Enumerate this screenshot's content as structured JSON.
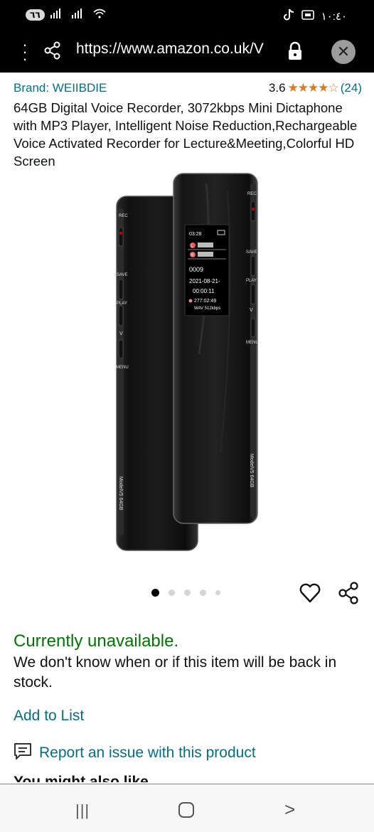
{
  "status_bar": {
    "badge": "٦٦",
    "time": "١٠:٤٠"
  },
  "browser": {
    "url": "https://www.amazon.co.uk/V"
  },
  "product": {
    "brand": "Brand: WEIIBDIE",
    "rating_value": "3.6",
    "rating_stars": 3.6,
    "rating_count": "(24)",
    "title": "64GB Digital Voice Recorder, 3072kbps Mini Dictaphone with MP3 Player, Intelligent Noise Reduction,Rechargeable Voice Activated Recorder for Lecture&Meeting,Colorful HD Screen",
    "image": {
      "back_buttons": [
        "REC",
        "SAVE",
        "PLAY",
        "V",
        "MENU"
      ],
      "back_model": "ModelV5 64GB",
      "front_buttons": [
        "REC",
        "SAVE",
        "PLAY",
        "V",
        "MENU"
      ],
      "front_model": "ModelV5 64GB",
      "screen_time": "03:28",
      "screen_channel_l": "L",
      "screen_channel_r": "R",
      "screen_file": "0009",
      "screen_date": "2021-08-21-",
      "screen_elapsed": "00:00:11",
      "screen_remaining": "277:02:49",
      "screen_format": "WAV 512kbps"
    },
    "carousel": {
      "total": 5,
      "active_index": 0
    }
  },
  "availability": {
    "status": "Currently unavailable.",
    "note": "We don't know when or if this item will be back in stock."
  },
  "actions": {
    "add_to_list": "Add to List",
    "report_issue": "Report an issue with this product"
  },
  "next_section_partial": "You might also like"
}
